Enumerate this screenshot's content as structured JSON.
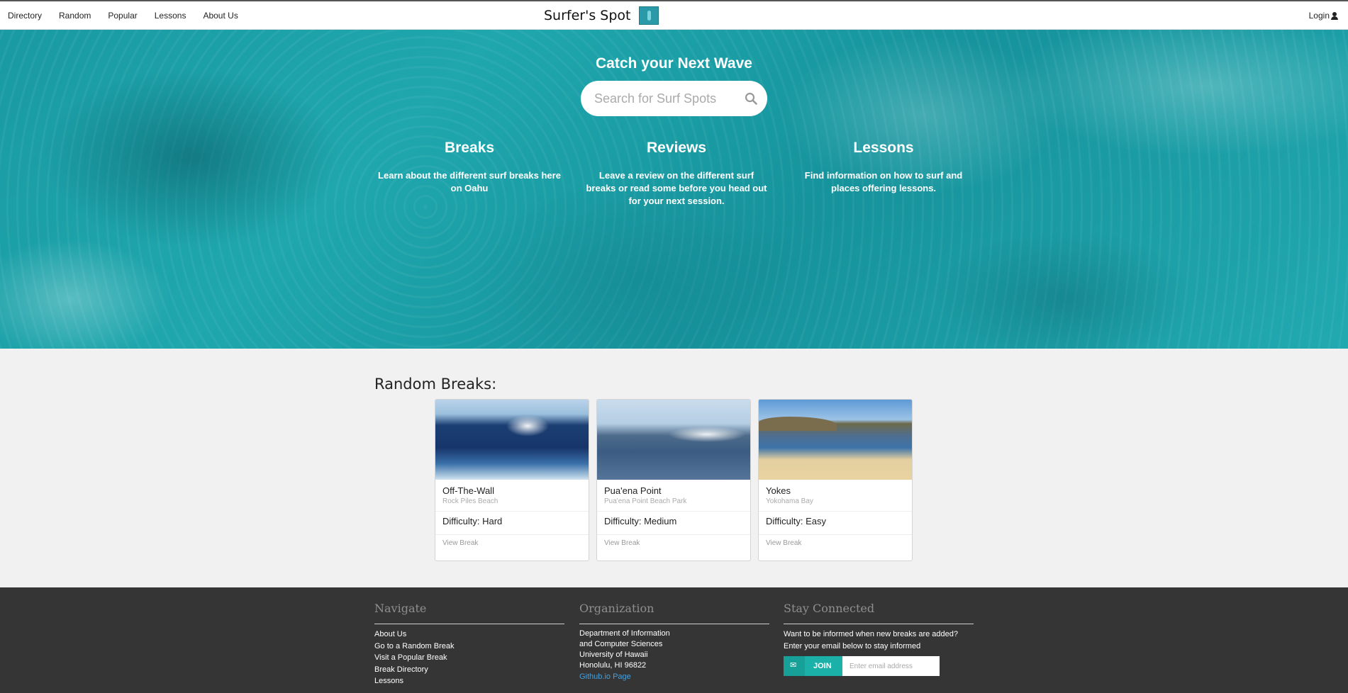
{
  "nav": {
    "links": [
      "Directory",
      "Random",
      "Popular",
      "Lessons",
      "About Us"
    ],
    "brand": "Surfer's Spot",
    "login": "Login"
  },
  "hero": {
    "title": "Catch your Next Wave",
    "search_placeholder": "Search for Surf Spots",
    "features": [
      {
        "title": "Breaks",
        "text": "Learn about the different surf breaks here on Oahu"
      },
      {
        "title": "Reviews",
        "text": "Leave a review on the different surf breaks or read some before you head out for your next session."
      },
      {
        "title": "Lessons",
        "text": "Find information on how to surf and places offering lessons."
      }
    ]
  },
  "random_breaks": {
    "title": "Random Breaks:",
    "cards": [
      {
        "name": "Off-The-Wall",
        "location": "Rock Piles Beach",
        "difficulty": "Difficulty: Hard",
        "link": "View Break"
      },
      {
        "name": "Pua'ena Point",
        "location": "Pua'ena Point Beach Park",
        "difficulty": "Difficulty: Medium",
        "link": "View Break"
      },
      {
        "name": "Yokes",
        "location": "Yokohama Bay",
        "difficulty": "Difficulty: Easy",
        "link": "View Break"
      }
    ]
  },
  "footer": {
    "navigate": {
      "title": "Navigate",
      "items": [
        "About Us",
        "Go to a Random Break",
        "Visit a Popular Break",
        "Break Directory",
        "Lessons"
      ]
    },
    "organization": {
      "title": "Organization",
      "lines": [
        "Department of Information",
        "and Computer Sciences",
        "University of Hawaii",
        "Honolulu, HI 96822"
      ],
      "link": "Github.io Page"
    },
    "connected": {
      "title": "Stay Connected",
      "lines": [
        "Want to be informed when new breaks are added?",
        "Enter your email below to stay informed"
      ],
      "join_label": "JOIN",
      "email_placeholder": "Enter email address"
    }
  }
}
